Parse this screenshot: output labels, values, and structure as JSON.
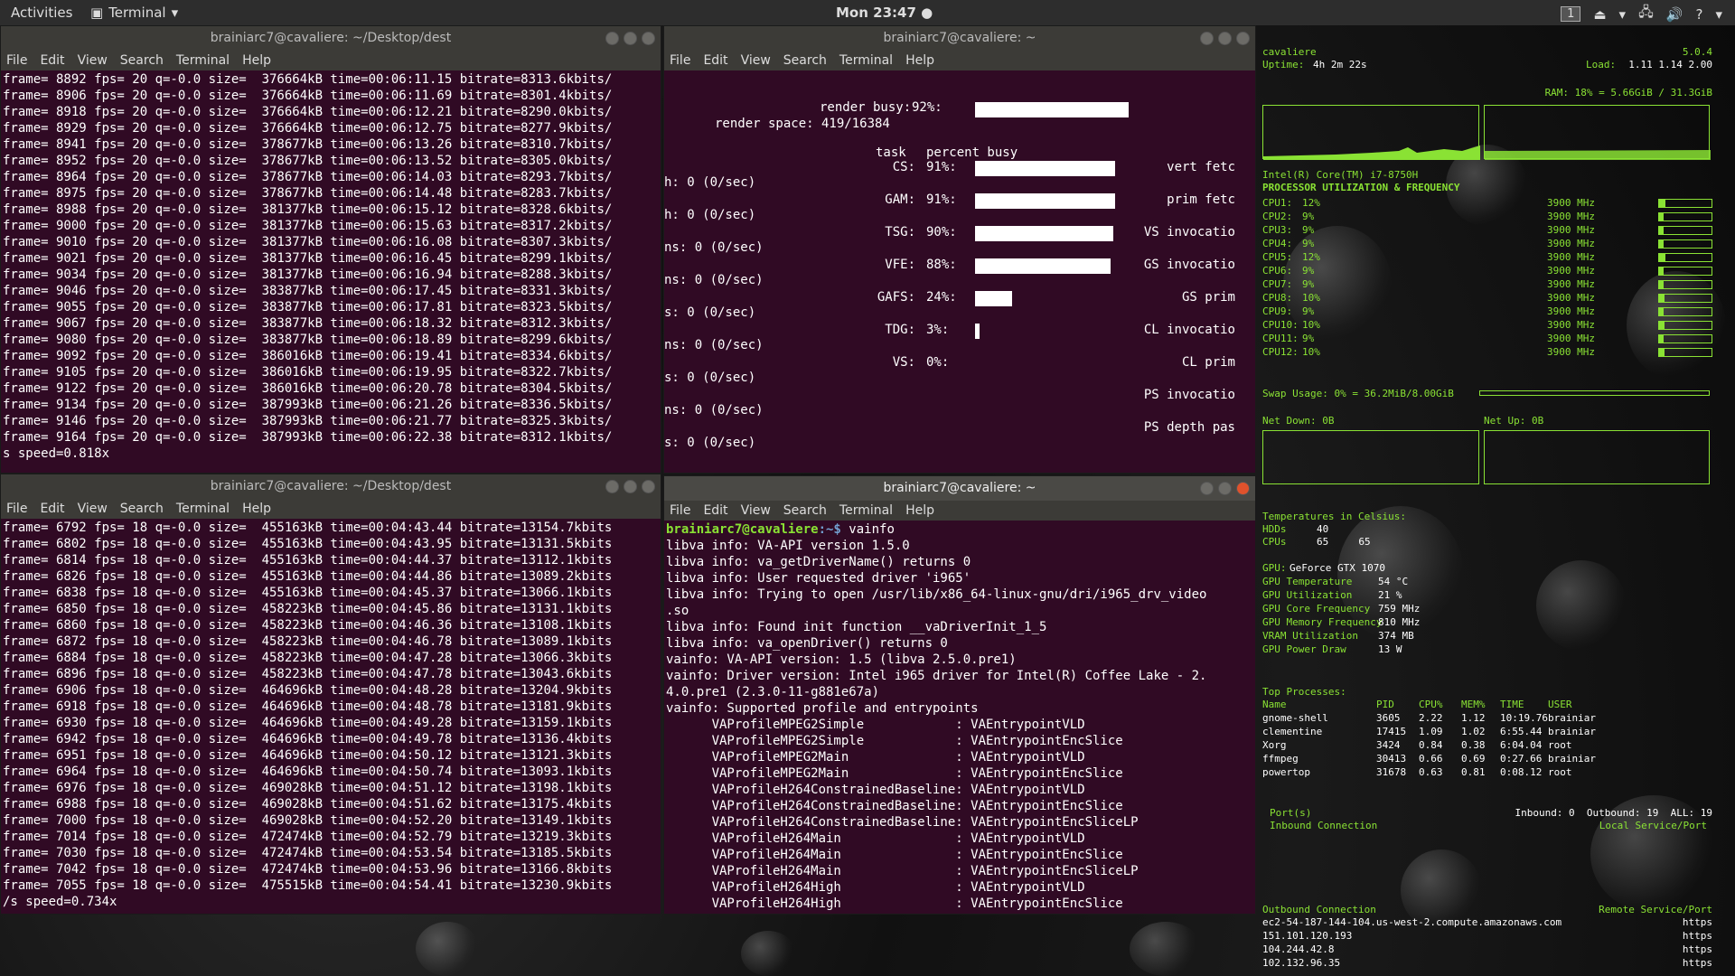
{
  "topbar": {
    "activities": "Activities",
    "app_name": "Terminal",
    "clock": "Mon 23:47",
    "workspace": "1"
  },
  "term1": {
    "title": "brainiarc7@cavaliere: ~/Desktop/dest",
    "menu": [
      "File",
      "Edit",
      "View",
      "Search",
      "Terminal",
      "Help"
    ],
    "lines": [
      "frame= 8892 fps= 20 q=-0.0 size=  376664kB time=00:06:11.15 bitrate=8313.6kbits/",
      "frame= 8906 fps= 20 q=-0.0 size=  376664kB time=00:06:11.69 bitrate=8301.4kbits/",
      "frame= 8918 fps= 20 q=-0.0 size=  376664kB time=00:06:12.21 bitrate=8290.0kbits/",
      "frame= 8929 fps= 20 q=-0.0 size=  376664kB time=00:06:12.75 bitrate=8277.9kbits/",
      "frame= 8941 fps= 20 q=-0.0 size=  378677kB time=00:06:13.26 bitrate=8310.7kbits/",
      "frame= 8952 fps= 20 q=-0.0 size=  378677kB time=00:06:13.52 bitrate=8305.0kbits/",
      "frame= 8964 fps= 20 q=-0.0 size=  378677kB time=00:06:14.03 bitrate=8293.7kbits/",
      "frame= 8975 fps= 20 q=-0.0 size=  378677kB time=00:06:14.48 bitrate=8283.7kbits/",
      "frame= 8988 fps= 20 q=-0.0 size=  381377kB time=00:06:15.12 bitrate=8328.6kbits/",
      "frame= 9000 fps= 20 q=-0.0 size=  381377kB time=00:06:15.63 bitrate=8317.2kbits/",
      "frame= 9010 fps= 20 q=-0.0 size=  381377kB time=00:06:16.08 bitrate=8307.3kbits/",
      "frame= 9021 fps= 20 q=-0.0 size=  381377kB time=00:06:16.45 bitrate=8299.1kbits/",
      "frame= 9034 fps= 20 q=-0.0 size=  381377kB time=00:06:16.94 bitrate=8288.3kbits/",
      "frame= 9046 fps= 20 q=-0.0 size=  383877kB time=00:06:17.45 bitrate=8331.3kbits/",
      "frame= 9055 fps= 20 q=-0.0 size=  383877kB time=00:06:17.81 bitrate=8323.5kbits/",
      "frame= 9067 fps= 20 q=-0.0 size=  383877kB time=00:06:18.32 bitrate=8312.3kbits/",
      "frame= 9080 fps= 20 q=-0.0 size=  383877kB time=00:06:18.89 bitrate=8299.6kbits/",
      "frame= 9092 fps= 20 q=-0.0 size=  386016kB time=00:06:19.41 bitrate=8334.6kbits/",
      "frame= 9105 fps= 20 q=-0.0 size=  386016kB time=00:06:19.95 bitrate=8322.7kbits/",
      "frame= 9122 fps= 20 q=-0.0 size=  386016kB time=00:06:20.78 bitrate=8304.5kbits/",
      "frame= 9134 fps= 20 q=-0.0 size=  387993kB time=00:06:21.26 bitrate=8336.5kbits/",
      "frame= 9146 fps= 20 q=-0.0 size=  387993kB time=00:06:21.77 bitrate=8325.3kbits/",
      "frame= 9164 fps= 20 q=-0.0 size=  387993kB time=00:06:22.38 bitrate=8312.1kbits/",
      "s speed=0.818x"
    ]
  },
  "term2": {
    "title": "brainiarc7@cavaliere: ~",
    "menu": [
      "File",
      "Edit",
      "View",
      "Search",
      "Terminal",
      "Help"
    ],
    "render_busy_label": "render busy:",
    "render_busy_pct": "92%:",
    "render_busy_value": 0.92,
    "render_space": "render space: 419/16384",
    "header_task": "task",
    "header_pct": "percent busy",
    "left_col": [
      "h: 0 (0/sec)",
      "h: 0 (0/sec)",
      "ns: 0 (0/sec)",
      "ns: 0 (0/sec)",
      "s: 0 (0/sec)",
      "ns: 0 (0/sec)",
      "s: 0 (0/sec)",
      "ns: 0 (0/sec)",
      "s: 0 (0/sec)"
    ],
    "tasks": [
      {
        "name": "CS:",
        "pct": "91%:",
        "value": 0.91,
        "right": "vert fetc"
      },
      {
        "name": "GAM:",
        "pct": "91%:",
        "value": 0.91,
        "right": "prim fetc"
      },
      {
        "name": "TSG:",
        "pct": "90%:",
        "value": 0.9,
        "right": "VS invocatio"
      },
      {
        "name": "VFE:",
        "pct": "88%:",
        "value": 0.88,
        "right": "GS invocatio"
      },
      {
        "name": "GAFS:",
        "pct": "24%:",
        "value": 0.24,
        "right": "GS prim"
      },
      {
        "name": "TDG:",
        "pct": "3%:",
        "value": 0.03,
        "right": "CL invocatio"
      },
      {
        "name": "VS:",
        "pct": "0%:",
        "value": 0.0,
        "right": "CL prim"
      }
    ],
    "extra_right": [
      "PS invocatio",
      "PS depth pas"
    ]
  },
  "term3": {
    "title": "brainiarc7@cavaliere: ~/Desktop/dest",
    "menu": [
      "File",
      "Edit",
      "View",
      "Search",
      "Terminal",
      "Help"
    ],
    "lines": [
      "frame= 6792 fps= 18 q=-0.0 size=  455163kB time=00:04:43.44 bitrate=13154.7kbits",
      "frame= 6802 fps= 18 q=-0.0 size=  455163kB time=00:04:43.95 bitrate=13131.5kbits",
      "frame= 6814 fps= 18 q=-0.0 size=  455163kB time=00:04:44.37 bitrate=13112.1kbits",
      "frame= 6826 fps= 18 q=-0.0 size=  455163kB time=00:04:44.86 bitrate=13089.2kbits",
      "frame= 6838 fps= 18 q=-0.0 size=  455163kB time=00:04:45.37 bitrate=13066.1kbits",
      "frame= 6850 fps= 18 q=-0.0 size=  458223kB time=00:04:45.86 bitrate=13131.1kbits",
      "frame= 6860 fps= 18 q=-0.0 size=  458223kB time=00:04:46.36 bitrate=13108.1kbits",
      "frame= 6872 fps= 18 q=-0.0 size=  458223kB time=00:04:46.78 bitrate=13089.1kbits",
      "frame= 6884 fps= 18 q=-0.0 size=  458223kB time=00:04:47.28 bitrate=13066.3kbits",
      "frame= 6896 fps= 18 q=-0.0 size=  458223kB time=00:04:47.78 bitrate=13043.6kbits",
      "frame= 6906 fps= 18 q=-0.0 size=  464696kB time=00:04:48.28 bitrate=13204.9kbits",
      "frame= 6918 fps= 18 q=-0.0 size=  464696kB time=00:04:48.78 bitrate=13181.9kbits",
      "frame= 6930 fps= 18 q=-0.0 size=  464696kB time=00:04:49.28 bitrate=13159.1kbits",
      "frame= 6942 fps= 18 q=-0.0 size=  464696kB time=00:04:49.78 bitrate=13136.4kbits",
      "frame= 6951 fps= 18 q=-0.0 size=  464696kB time=00:04:50.12 bitrate=13121.3kbits",
      "frame= 6964 fps= 18 q=-0.0 size=  464696kB time=00:04:50.74 bitrate=13093.1kbits",
      "frame= 6976 fps= 18 q=-0.0 size=  469028kB time=00:04:51.12 bitrate=13198.1kbits",
      "frame= 6988 fps= 18 q=-0.0 size=  469028kB time=00:04:51.62 bitrate=13175.4kbits",
      "frame= 7000 fps= 18 q=-0.0 size=  469028kB time=00:04:52.20 bitrate=13149.1kbits",
      "frame= 7014 fps= 18 q=-0.0 size=  472474kB time=00:04:52.79 bitrate=13219.3kbits",
      "frame= 7030 fps= 18 q=-0.0 size=  472474kB time=00:04:53.54 bitrate=13185.5kbits",
      "frame= 7042 fps= 18 q=-0.0 size=  472474kB time=00:04:53.96 bitrate=13166.8kbits",
      "frame= 7055 fps= 18 q=-0.0 size=  475515kB time=00:04:54.41 bitrate=13230.9kbits",
      "/s speed=0.734x"
    ]
  },
  "term4": {
    "title": "brainiarc7@cavaliere: ~",
    "menu": [
      "File",
      "Edit",
      "View",
      "Search",
      "Terminal",
      "Help"
    ],
    "prompt_user": "brainiarc7@cavaliere",
    "prompt_path": ":~$ ",
    "command": "vainfo",
    "lines": [
      "libva info: VA-API version 1.5.0",
      "libva info: va_getDriverName() returns 0",
      "libva info: User requested driver 'i965'",
      "libva info: Trying to open /usr/lib/x86_64-linux-gnu/dri/i965_drv_video",
      ".so",
      "libva info: Found init function __vaDriverInit_1_5",
      "libva info: va_openDriver() returns 0",
      "vainfo: VA-API version: 1.5 (libva 2.5.0.pre1)",
      "vainfo: Driver version: Intel i965 driver for Intel(R) Coffee Lake - 2.",
      "4.0.pre1 (2.3.0-11-g881e67a)",
      "vainfo: Supported profile and entrypoints",
      "      VAProfileMPEG2Simple            : VAEntrypointVLD",
      "      VAProfileMPEG2Simple            : VAEntrypointEncSlice",
      "      VAProfileMPEG2Main              : VAEntrypointVLD",
      "      VAProfileMPEG2Main              : VAEntrypointEncSlice",
      "      VAProfileH264ConstrainedBaseline: VAEntrypointVLD",
      "      VAProfileH264ConstrainedBaseline: VAEntrypointEncSlice",
      "      VAProfileH264ConstrainedBaseline: VAEntrypointEncSliceLP",
      "      VAProfileH264Main               : VAEntrypointVLD",
      "      VAProfileH264Main               : VAEntrypointEncSlice",
      "      VAProfileH264Main               : VAEntrypointEncSliceLP",
      "      VAProfileH264High               : VAEntrypointVLD",
      "      VAProfileH264High               : VAEntrypointEncSlice"
    ]
  },
  "conky": {
    "hostname": "cavaliere",
    "kernel": "5.0.4",
    "uptime_label": "Uptime:",
    "uptime": "4h 2m 22s",
    "load_label": "Load:",
    "load": "1.11 1.14 2.00",
    "ram": "RAM: 18% = 5.66GiB / 31.3GiB",
    "cpu_model": "Intel(R) Core(TM) i7-8750H",
    "cpu_header": "PROCESSOR UTILIZATION & FREQUENCY",
    "cpus": [
      {
        "label": "CPU1:",
        "pct": "12%",
        "freq": "3900 MHz",
        "value": 0.12
      },
      {
        "label": "CPU2:",
        "pct": "9%",
        "freq": "3900 MHz",
        "value": 0.09
      },
      {
        "label": "CPU3:",
        "pct": "9%",
        "freq": "3900 MHz",
        "value": 0.09
      },
      {
        "label": "CPU4:",
        "pct": "9%",
        "freq": "3900 MHz",
        "value": 0.09
      },
      {
        "label": "CPU5:",
        "pct": "12%",
        "freq": "3900 MHz",
        "value": 0.12
      },
      {
        "label": "CPU6:",
        "pct": "9%",
        "freq": "3900 MHz",
        "value": 0.09
      },
      {
        "label": "CPU7:",
        "pct": "9%",
        "freq": "3900 MHz",
        "value": 0.09
      },
      {
        "label": "CPU8:",
        "pct": "10%",
        "freq": "3900 MHz",
        "value": 0.1
      },
      {
        "label": "CPU9:",
        "pct": "9%",
        "freq": "3900 MHz",
        "value": 0.09
      },
      {
        "label": "CPU10:",
        "pct": "10%",
        "freq": "3900 MHz",
        "value": 0.1
      },
      {
        "label": "CPU11:",
        "pct": "9%",
        "freq": "3900 MHz",
        "value": 0.09
      },
      {
        "label": "CPU12:",
        "pct": "10%",
        "freq": "3900 MHz",
        "value": 0.1
      }
    ],
    "swap": "Swap Usage: 0% = 36.2MiB/8.00GiB",
    "net_down": "Net Down: 0B",
    "net_up": "Net Up: 0B",
    "temps_header": "Temperatures in Celsius:",
    "hdds_label": "HDDs",
    "hdds": "40",
    "cpus_label": "CPUs",
    "cpus_temp": "65     65",
    "gpu_label": "GPU:",
    "gpu_name": "GeForce GTX 1070",
    "gpu_rows": [
      {
        "label": "GPU Temperature",
        "value": "54 °C"
      },
      {
        "label": "GPU Utilization",
        "value": "21 %"
      },
      {
        "label": "GPU Core Frequency",
        "value": "759 MHz"
      },
      {
        "label": "GPU Memory Frequency",
        "value": "810 MHz"
      },
      {
        "label": "VRAM Utilization",
        "value": "374 MB"
      },
      {
        "label": "GPU Power Draw",
        "value": "13 W"
      }
    ],
    "top_header": "Top Processes:",
    "top_cols": [
      "Name",
      "PID",
      "CPU%",
      "MEM%",
      "TIME",
      "USER"
    ],
    "top_rows": [
      [
        "gnome-shell",
        "3605",
        "2.22",
        "1.12",
        "10:19.76",
        "brainiar"
      ],
      [
        "clementine",
        "17415",
        "1.09",
        "1.02",
        "6:55.44",
        "brainiar"
      ],
      [
        "Xorg",
        "3424",
        "0.84",
        "0.38",
        "6:04.04",
        "root"
      ],
      [
        "ffmpeg",
        "30413",
        "0.66",
        "0.69",
        "0:27.66",
        "brainiar"
      ],
      [
        "powertop",
        "31678",
        "0.63",
        "0.81",
        "0:08.12",
        "root"
      ]
    ],
    "ports": "Port(s)",
    "inbound_conn": "Inbound Connection",
    "inbound_summary": "Inbound: 0  Outbound: 19  ALL: 19",
    "local_service": "Local Service/Port",
    "outbound_conn": "Outbound Connection",
    "remote_service": "Remote Service/Port",
    "outbound_rows": [
      [
        "ec2-54-187-144-104.us-west-2.compute.amazonaws.com",
        "https"
      ],
      [
        "151.101.120.193",
        "https"
      ],
      [
        "104.244.42.8",
        "https"
      ],
      [
        "102.132.96.35",
        "https"
      ]
    ]
  }
}
